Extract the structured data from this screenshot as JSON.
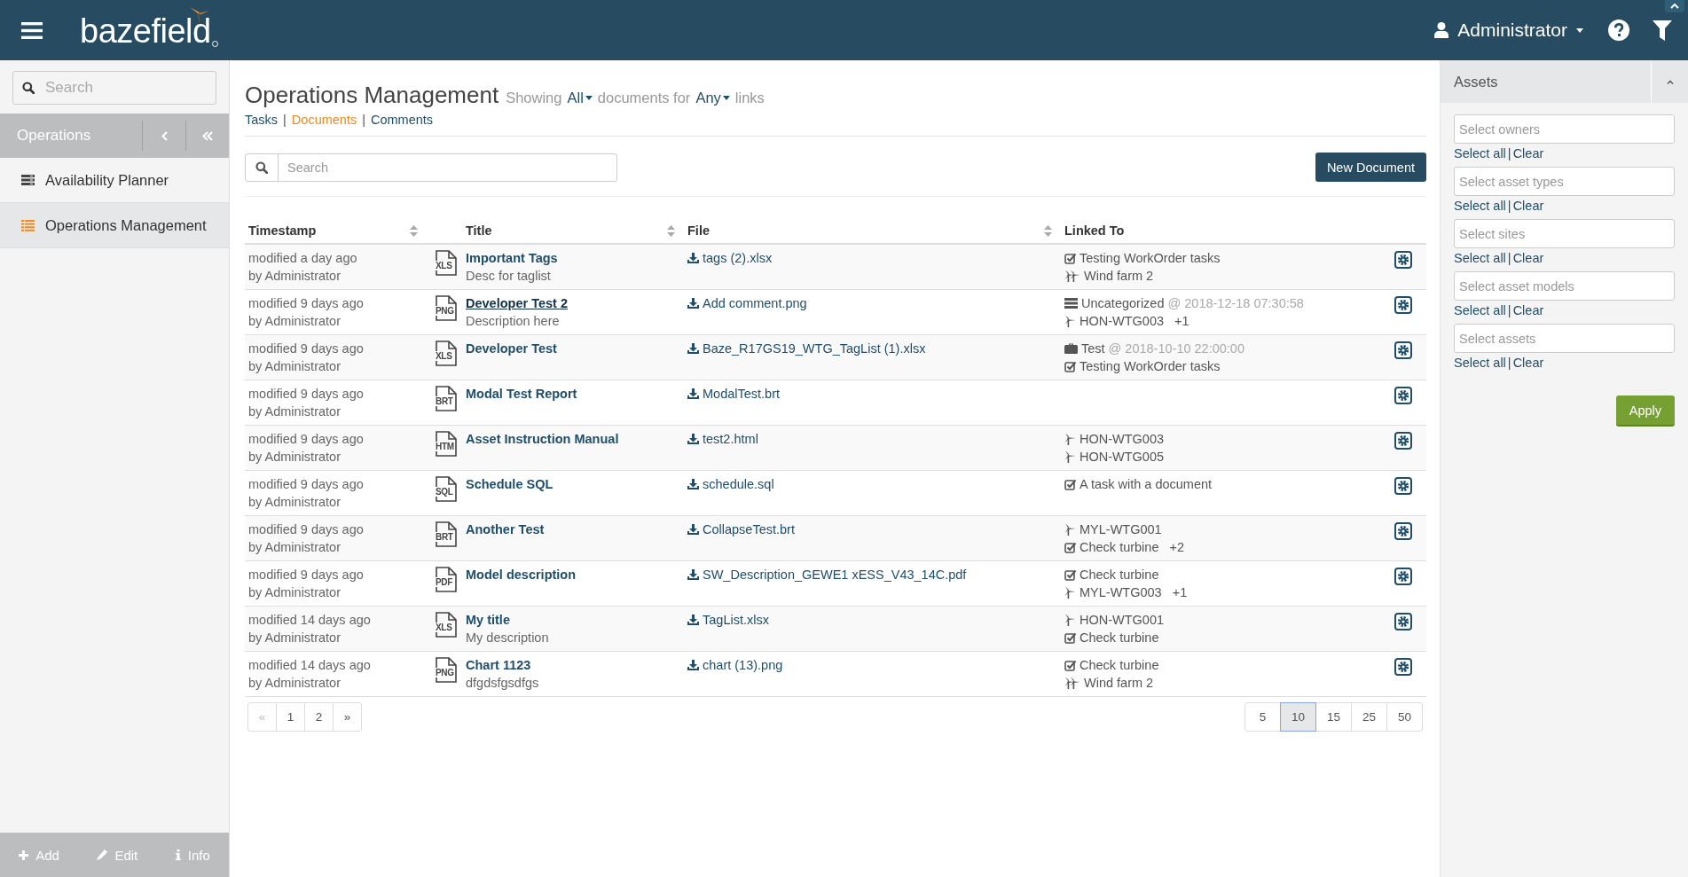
{
  "header": {
    "logo": "bazefield",
    "user": "Administrator"
  },
  "sidebar": {
    "search_placeholder": "Search",
    "section": "Operations",
    "items": [
      {
        "label": "Availability Planner",
        "kind": "planner",
        "selected": false
      },
      {
        "label": "Operations Management",
        "kind": "list",
        "selected": true
      }
    ],
    "footer_buttons": [
      {
        "label": "Add",
        "kind": "add"
      },
      {
        "label": "Edit",
        "kind": "edit"
      },
      {
        "label": "Info",
        "kind": "info"
      }
    ]
  },
  "main": {
    "title": "Operations Management",
    "showing": "Showing",
    "scope": "All",
    "documents_for": "documents for",
    "link_filter": "Any",
    "links": "links",
    "tab_separator": "|",
    "tabs": [
      {
        "label": "Tasks",
        "selected": false
      },
      {
        "label": "Documents",
        "selected": true
      },
      {
        "label": "Comments",
        "selected": false
      }
    ],
    "search_placeholder": "Search",
    "new_button": "New Document",
    "columns": [
      {
        "label": "Timestamp",
        "kind": "sortable"
      },
      {
        "label": "Title",
        "kind": "sortable"
      },
      {
        "label": "File",
        "kind": "sortable"
      },
      {
        "label": "Linked To",
        "kind": "plain"
      }
    ],
    "rows": [
      {
        "modified": "modified a day ago",
        "author": "by Administrator",
        "type": "XLS",
        "title": "Important Tags",
        "hovered": false,
        "description": "Desc for taglist",
        "file": "tags (2).xlsx",
        "links": [
          {
            "kind": "task",
            "text": "Testing WorkOrder tasks"
          },
          {
            "kind": "site",
            "text": "Wind farm 2"
          }
        ]
      },
      {
        "modified": "modified 9 days ago",
        "author": "by Administrator",
        "type": "PNG",
        "title": "Developer Test 2",
        "hovered": true,
        "description": "Description here",
        "file": "Add comment.png",
        "links": [
          {
            "kind": "category",
            "text": "Uncategorized",
            "time": "@ 2018-12-18 07:30:58"
          },
          {
            "kind": "asset",
            "text": "HON-WTG003",
            "extra": "+1"
          }
        ]
      },
      {
        "modified": "modified 9 days ago",
        "author": "by Administrator",
        "type": "XLS",
        "title": "Developer Test",
        "hovered": false,
        "file": "Baze_R17GS19_WTG_TagList (1).xlsx",
        "links": [
          {
            "kind": "event",
            "text": "Test",
            "time": "@ 2018-10-10 22:00:00"
          },
          {
            "kind": "task",
            "text": "Testing WorkOrder tasks"
          }
        ]
      },
      {
        "modified": "modified 9 days ago",
        "author": "by Administrator",
        "type": "BRT",
        "title": "Modal Test Report",
        "hovered": false,
        "file": "ModalTest.brt"
      },
      {
        "modified": "modified 9 days ago",
        "author": "by Administrator",
        "type": "HTM",
        "title": "Asset Instruction Manual",
        "hovered": false,
        "file": "test2.html",
        "links": [
          {
            "kind": "asset",
            "text": "HON-WTG003"
          },
          {
            "kind": "asset",
            "text": "HON-WTG005"
          }
        ]
      },
      {
        "modified": "modified 9 days ago",
        "author": "by Administrator",
        "type": "SQL",
        "title": "Schedule SQL",
        "hovered": false,
        "file": "schedule.sql",
        "links": [
          {
            "kind": "task",
            "text": "A task with a document"
          }
        ]
      },
      {
        "modified": "modified 9 days ago",
        "author": "by Administrator",
        "type": "BRT",
        "title": "Another Test",
        "hovered": false,
        "file": "CollapseTest.brt",
        "links": [
          {
            "kind": "asset",
            "text": "MYL-WTG001"
          },
          {
            "kind": "task",
            "text": "Check turbine",
            "extra": "+2"
          }
        ]
      },
      {
        "modified": "modified 9 days ago",
        "author": "by Administrator",
        "type": "PDF",
        "title": "Model description",
        "hovered": false,
        "file": "SW_Description_GEWE1 xESS_V43_14C.pdf",
        "links": [
          {
            "kind": "task",
            "text": "Check turbine"
          },
          {
            "kind": "asset",
            "text": "MYL-WTG003",
            "extra": "+1"
          }
        ]
      },
      {
        "modified": "modified 14 days ago",
        "author": "by Administrator",
        "type": "XLS",
        "title": "My title",
        "hovered": false,
        "description": "My description",
        "file": "TagList.xlsx",
        "links": [
          {
            "kind": "asset",
            "text": "HON-WTG001"
          },
          {
            "kind": "task",
            "text": "Check turbine"
          }
        ]
      },
      {
        "modified": "modified 14 days ago",
        "author": "by Administrator",
        "type": "PNG",
        "title": "Chart 1123",
        "hovered": false,
        "description": "dfgdsfgsdfgs",
        "file": "chart (13).png",
        "links": [
          {
            "kind": "task",
            "text": "Check turbine"
          },
          {
            "kind": "site",
            "text": "Wind farm 2"
          }
        ]
      }
    ],
    "pagination": [
      {
        "label": "«",
        "disabled": true
      },
      {
        "label": "1",
        "disabled": false
      },
      {
        "label": "2",
        "disabled": false
      },
      {
        "label": "»",
        "disabled": false
      }
    ],
    "page_sizes": [
      {
        "label": "5",
        "selected": false
      },
      {
        "label": "10",
        "selected": true
      },
      {
        "label": "15",
        "selected": false
      },
      {
        "label": "25",
        "selected": false
      },
      {
        "label": "50",
        "selected": false
      }
    ]
  },
  "filter_panel": {
    "title": "Assets",
    "fields": [
      {
        "placeholder": "Select owners",
        "select_all": "Select all",
        "separator": "|",
        "clear": "Clear"
      },
      {
        "placeholder": "Select asset types",
        "select_all": "Select all",
        "separator": "|",
        "clear": "Clear"
      },
      {
        "placeholder": "Select sites",
        "select_all": "Select all",
        "separator": "|",
        "clear": "Clear"
      },
      {
        "placeholder": "Select asset models",
        "select_all": "Select all",
        "separator": "|",
        "clear": "Clear"
      },
      {
        "placeholder": "Select assets",
        "select_all": "Select all",
        "separator": "|",
        "clear": "Clear"
      }
    ],
    "apply": "Apply"
  }
}
